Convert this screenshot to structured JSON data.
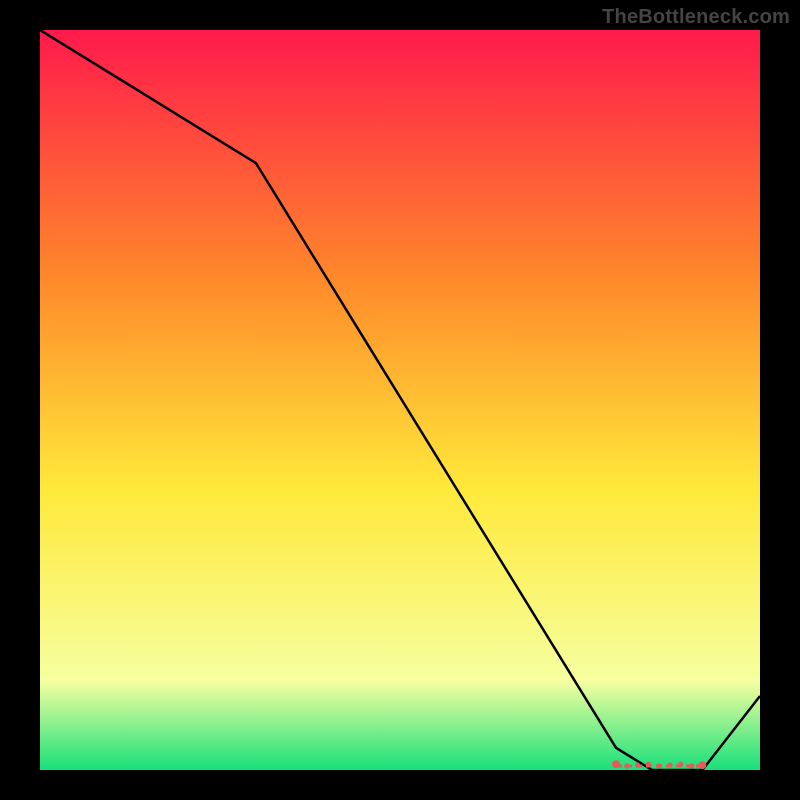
{
  "watermark": "TheBottleneck.com",
  "chart_data": {
    "type": "line",
    "title": "",
    "xlabel": "",
    "ylabel": "",
    "xlim": [
      0,
      100
    ],
    "ylim": [
      0,
      100
    ],
    "x": [
      0,
      30,
      80,
      85,
      88,
      92,
      100
    ],
    "values": [
      100,
      82,
      3,
      0,
      0,
      0,
      10
    ],
    "optimum_region_x": [
      80,
      92
    ],
    "background_gradient": {
      "top": "#ff1a4b",
      "upper": "#ff8a2a",
      "mid": "#ffe93a",
      "lower": "#f6ffa0",
      "bottom": "#18e07a"
    },
    "line_color": "#000000",
    "marker_color": "#e65a5a"
  }
}
